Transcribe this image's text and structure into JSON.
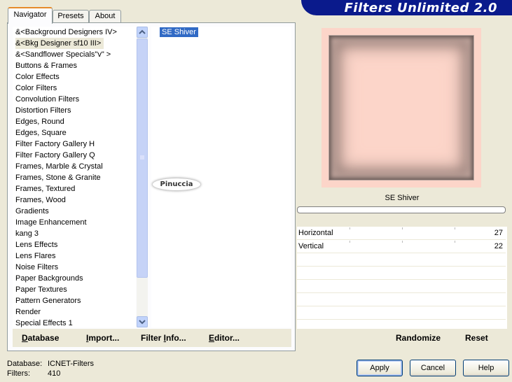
{
  "tabs": [
    "Navigator",
    "Presets",
    "About"
  ],
  "banner_title": "Filters Unlimited 2.0",
  "categories": [
    "&<Background Designers IV>",
    "&<Bkg Designer sf10 III>",
    "&<Sandflower Specials\"v\" >",
    "Buttons & Frames",
    "Color Effects",
    "Color Filters",
    "Convolution Filters",
    "Distortion Filters",
    "Edges, Round",
    "Edges, Square",
    "Filter Factory Gallery H",
    "Filter Factory Gallery Q",
    "Frames, Marble & Crystal",
    "Frames, Stone & Granite",
    "Frames, Textured",
    "Frames, Wood",
    "Gradients",
    "Image Enhancement",
    "kang 3",
    "Lens Effects",
    "Lens Flares",
    "Noise Filters",
    "Paper Backgrounds",
    "Paper Textures",
    "Pattern Generators",
    "Render",
    "Special Effects 1"
  ],
  "selected_category_index": 1,
  "selected_filter": "SE Shiver",
  "watermark_text": "Pinuccia",
  "left_buttons": {
    "database": "Database",
    "import": "Import...",
    "filter_info": "Filter Info...",
    "editor": "Editor..."
  },
  "preview_filter_name": "SE Shiver",
  "params": [
    {
      "label": "Horizontal",
      "value": "27"
    },
    {
      "label": "Vertical",
      "value": "22"
    }
  ],
  "right_buttons": {
    "randomize": "Randomize",
    "reset": "Reset"
  },
  "status": {
    "database_label": "Database:",
    "database_value": "ICNET-Filters",
    "filters_label": "Filters:",
    "filters_value": "410"
  },
  "dialog_buttons": {
    "apply": "Apply",
    "cancel": "Cancel",
    "help": "Help"
  },
  "colors": {
    "banner": "#0a1a8c",
    "selection": "#316ac5",
    "preview_fill": "#fcd5c9",
    "tab_accent": "#e68b2c"
  }
}
